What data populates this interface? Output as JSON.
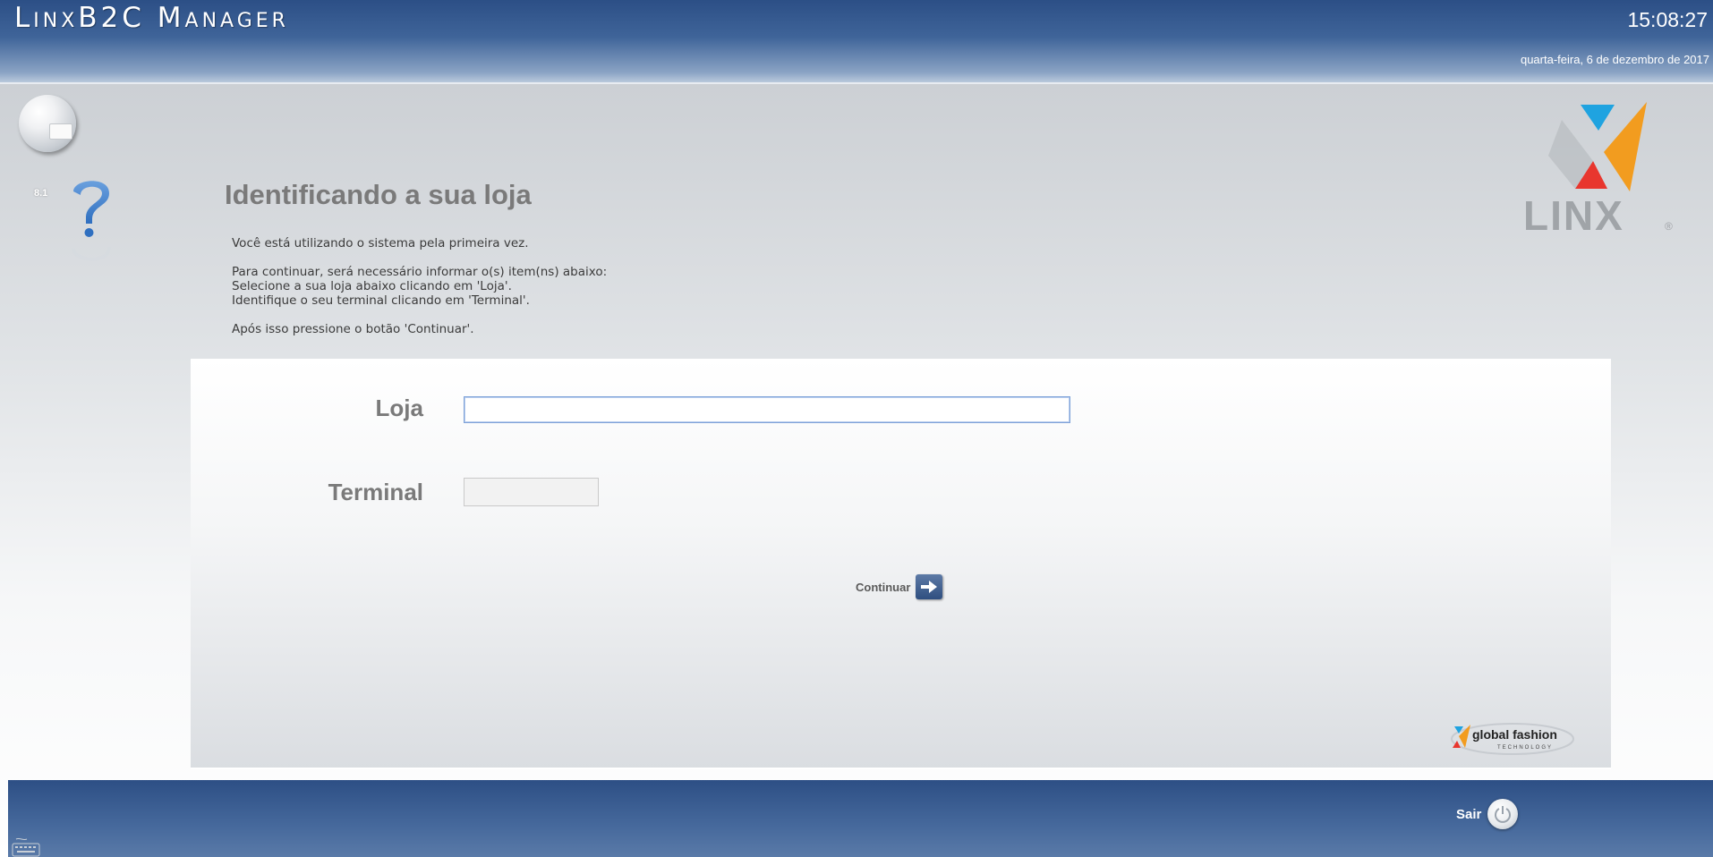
{
  "header": {
    "app_title": "LinxB2C Manager",
    "clock": "15:08:27",
    "date": "quarta-feira, 6 de dezembro de 2017"
  },
  "sidebar": {
    "version": "8.1",
    "globe_icon": "globe-icon",
    "help_icon": "question-mark-icon"
  },
  "logo": {
    "brand": "LINX",
    "colors": {
      "blue": "#1fa3e0",
      "orange": "#f29c1f",
      "red": "#e8362e",
      "gray": "#a0a4a8"
    }
  },
  "main": {
    "title": "Identificando a sua loja",
    "intro_lines": [
      "Você está utilizando o sistema pela primeira vez.",
      "Para continuar, será necessário informar o(s) item(ns) abaixo:",
      "Selecione a sua loja abaixo clicando em 'Loja'.",
      "Identifique o seu terminal clicando em 'Terminal'.",
      "Após isso pressione o botão 'Continuar'."
    ]
  },
  "form": {
    "loja_label": "Loja",
    "loja_value": "",
    "terminal_label": "Terminal",
    "terminal_value": "",
    "continue_label": "Continuar"
  },
  "footer_brand": {
    "name": "global fashion",
    "tagline": "TECHNOLOGY"
  },
  "footer": {
    "exit_label": "Sair"
  }
}
